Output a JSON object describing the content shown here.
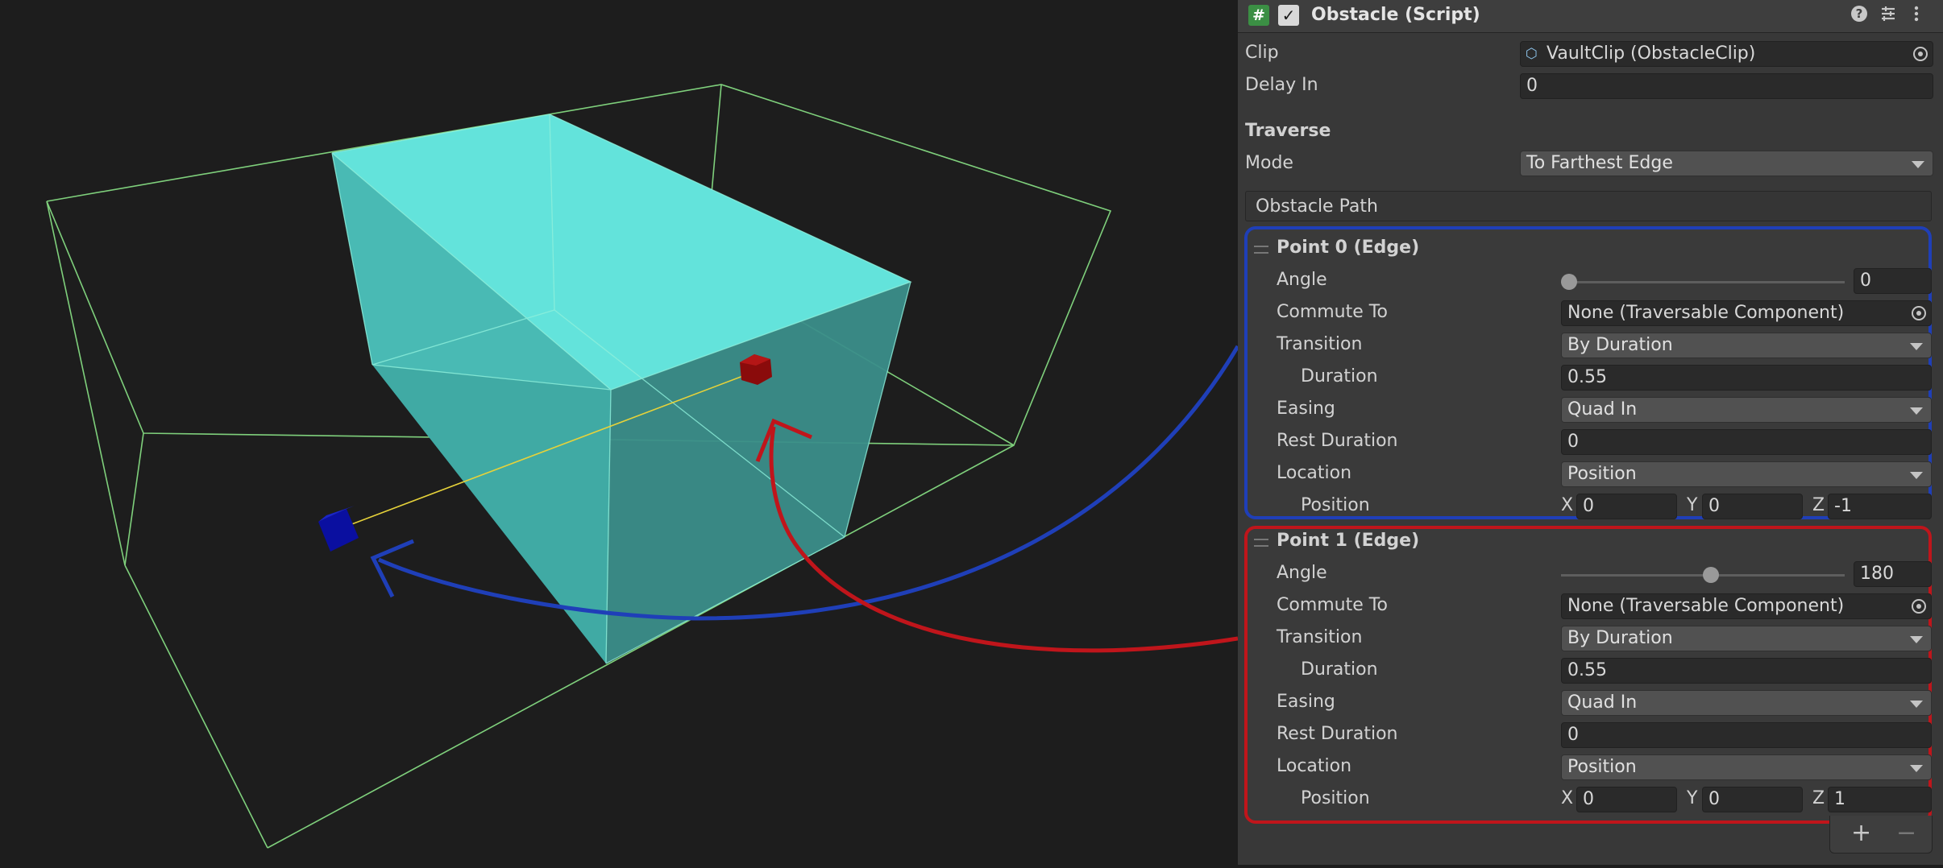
{
  "component": {
    "title": "Obstacle (Script)",
    "icons": [
      "script-icon",
      "enabled-checkbox",
      "help-icon",
      "preset-icon",
      "kebab-menu-icon"
    ]
  },
  "fields": {
    "clip_label": "Clip",
    "clip_value": "VaultClip (ObstacleClip)",
    "delay_label": "Delay In",
    "delay_value": "0",
    "traverse_header": "Traverse",
    "mode_label": "Mode",
    "mode_value": "To Farthest Edge",
    "path_label": "Obstacle Path"
  },
  "points": [
    {
      "title": "Point 0 (Edge)",
      "outline_color": "#1f3fb8",
      "angle_label": "Angle",
      "angle_value": "0",
      "angle_fraction": 0.0,
      "commute_label": "Commute To",
      "commute_value": "None (Traversable Component)",
      "transition_label": "Transition",
      "transition_value": "By Duration",
      "duration_label": "Duration",
      "duration_value": "0.55",
      "easing_label": "Easing",
      "easing_value": "Quad In",
      "rest_label": "Rest Duration",
      "rest_value": "0",
      "location_label": "Location",
      "location_value": "Position",
      "position_label": "Position",
      "x_label": "X",
      "x": "0",
      "y_label": "Y",
      "y": "0",
      "z_label": "Z",
      "z": "-1"
    },
    {
      "title": "Point 1 (Edge)",
      "outline_color": "#c0151b",
      "angle_label": "Angle",
      "angle_value": "180",
      "angle_fraction": 0.5,
      "commute_label": "Commute To",
      "commute_value": "None (Traversable Component)",
      "transition_label": "Transition",
      "transition_value": "By Duration",
      "duration_label": "Duration",
      "duration_value": "0.55",
      "easing_label": "Easing",
      "easing_value": "Quad In",
      "rest_label": "Rest Duration",
      "rest_value": "0",
      "location_label": "Location",
      "location_value": "Position",
      "position_label": "Position",
      "x_label": "X",
      "x": "0",
      "y_label": "Y",
      "y": "0",
      "z_label": "Z",
      "z": "1"
    }
  ],
  "list_footer": {
    "add": "+",
    "remove": "−"
  },
  "scene": {
    "box_face_color": "#5fe0d8",
    "wire_color": "#7fd07c",
    "start_marker_color": "#0a0fa0",
    "end_marker_color": "#8a0b0b",
    "path_line_color": "#e6d23a"
  }
}
